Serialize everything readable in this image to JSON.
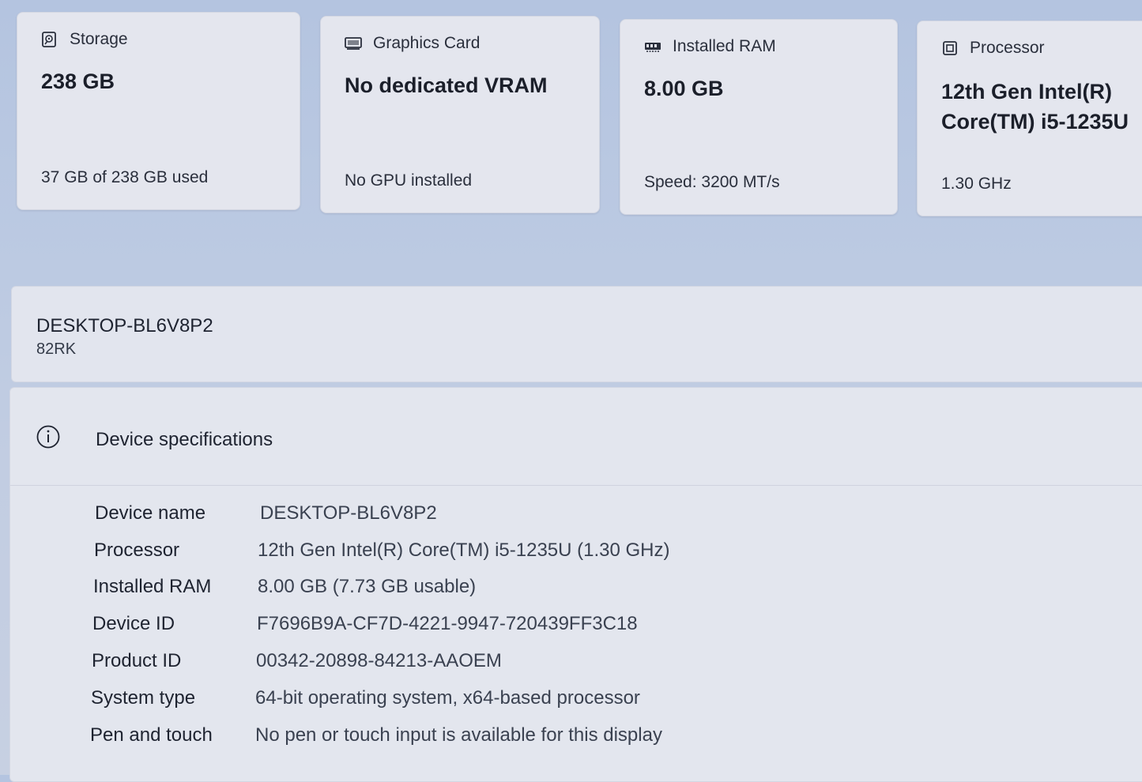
{
  "cards": {
    "storage": {
      "title": "Storage",
      "icon": "storage-icon",
      "value": "238 GB",
      "sub": "37 GB of 238 GB used"
    },
    "graphics": {
      "title": "Graphics Card",
      "icon": "graphics-card-icon",
      "value": "No dedicated VRAM",
      "sub": "No GPU installed"
    },
    "ram": {
      "title": "Installed RAM",
      "icon": "ram-icon",
      "value": "8.00 GB",
      "sub": "Speed: 3200 MT/s"
    },
    "processor": {
      "title": "Processor",
      "icon": "processor-icon",
      "value_line1": "12th Gen Intel(R)",
      "value_line2": "Core(TM) i5-1235U",
      "sub": "1.30 GHz"
    }
  },
  "device": {
    "hostname": "DESKTOP-BL6V8P2",
    "model": "82RK"
  },
  "specs": {
    "title": "Device specifications",
    "icon": "info-icon",
    "rows": [
      {
        "label": "Device name",
        "value": "DESKTOP-BL6V8P2"
      },
      {
        "label": "Processor",
        "value": "12th Gen Intel(R) Core(TM) i5-1235U (1.30 GHz)"
      },
      {
        "label": "Installed RAM",
        "value": "8.00 GB (7.73 GB usable)"
      },
      {
        "label": "Device ID",
        "value": "F7696B9A-CF7D-4221-9947-720439FF3C18"
      },
      {
        "label": "Product ID",
        "value": "00342-20898-84213-AAOEM"
      },
      {
        "label": "System type",
        "value": "64-bit operating system, x64-based processor"
      },
      {
        "label": "Pen and touch",
        "value": "No pen or touch input is available for this display"
      }
    ]
  }
}
